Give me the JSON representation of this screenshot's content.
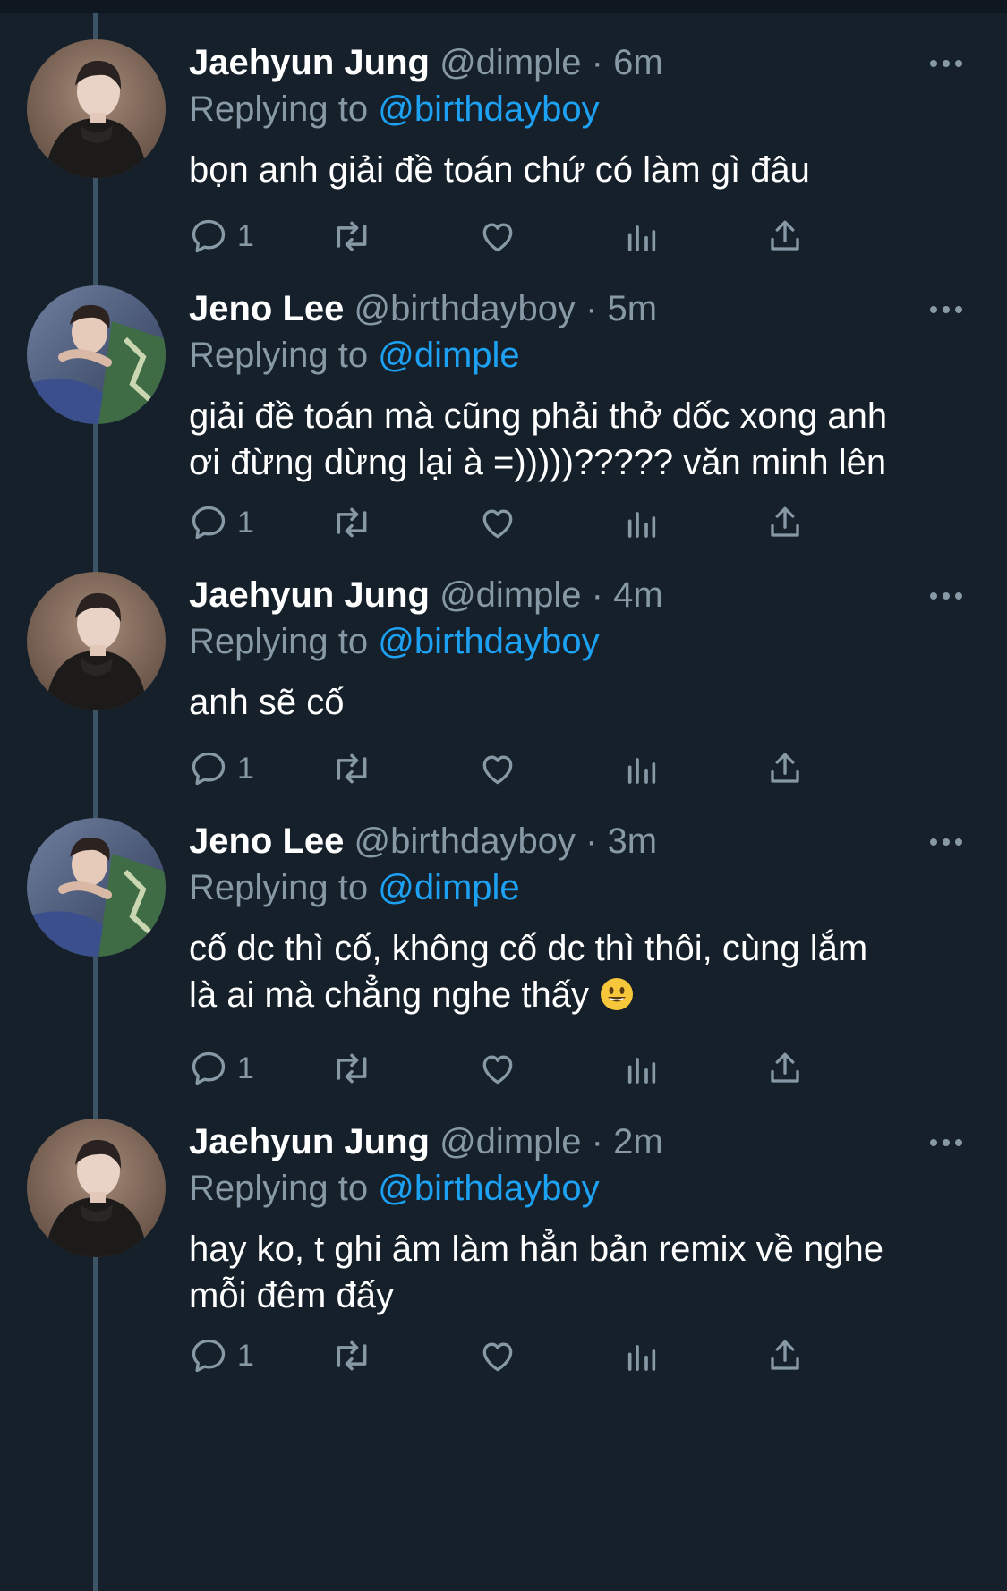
{
  "tweets": [
    {
      "name": "Jaehyun Jung",
      "handle": "@dimple",
      "dot": "·",
      "time": "6m",
      "replying_prefix": "Replying to ",
      "replying_to": "@birthdayboy",
      "text": "bọn anh giải đề toán chứ có làm gì đâu",
      "reply_count": "1",
      "avatar": "jaehyun"
    },
    {
      "name": "Jeno Lee",
      "handle": "@birthdayboy",
      "dot": "·",
      "time": "5m",
      "replying_prefix": "Replying to ",
      "replying_to": "@dimple",
      "text": "giải đề toán mà cũng phải thở dốc xong anh\nơi đừng dừng lại à =)))))????? văn minh lên",
      "reply_count": "1",
      "avatar": "jeno"
    },
    {
      "name": "Jaehyun Jung",
      "handle": "@dimple",
      "dot": "·",
      "time": "4m",
      "replying_prefix": "Replying to ",
      "replying_to": "@birthdayboy",
      "text": "anh sẽ cố",
      "reply_count": "1",
      "avatar": "jaehyun"
    },
    {
      "name": "Jeno Lee",
      "handle": "@birthdayboy",
      "dot": "·",
      "time": "3m",
      "replying_prefix": "Replying to ",
      "replying_to": "@dimple",
      "text": "cố dc thì cố, không cố dc thì thôi, cùng lắm\nlà ai mà chẳng nghe thấy ",
      "emoji": "grinning-face-emoji",
      "reply_count": "1",
      "avatar": "jeno"
    },
    {
      "name": "Jaehyun Jung",
      "handle": "@dimple",
      "dot": "·",
      "time": "2m",
      "replying_prefix": "Replying to ",
      "replying_to": "@birthdayboy",
      "text": "hay ko, t ghi âm làm hẳn bản remix về nghe\nmỗi đêm đấy",
      "reply_count": "1",
      "avatar": "jaehyun"
    }
  ],
  "icons": {
    "more": "more-icon",
    "reply": "reply-icon",
    "retweet": "retweet-icon",
    "like": "like-icon",
    "analytics": "analytics-icon",
    "share": "share-icon"
  },
  "colors": {
    "background": "#15202b",
    "text_primary": "#ffffff",
    "text_secondary": "#8899a6",
    "accent": "#1da1f2",
    "thread_line": "#3d5466"
  }
}
